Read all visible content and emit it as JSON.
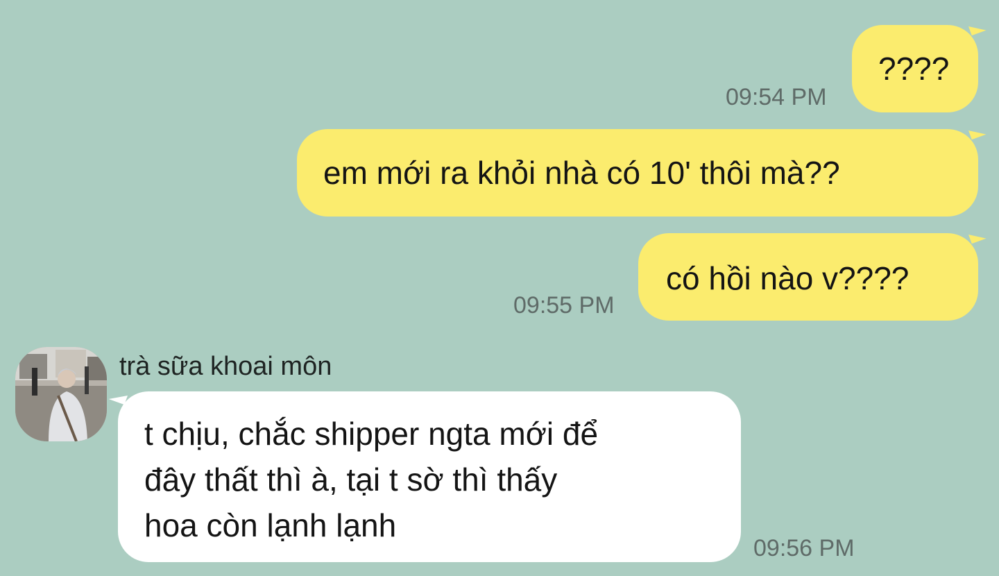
{
  "messages": [
    {
      "direction": "out",
      "text": "????",
      "time": "09:54 PM"
    },
    {
      "direction": "out",
      "text": "em mới ra khỏi nhà có 10' thôi mà??",
      "time": ""
    },
    {
      "direction": "out",
      "text": "có hồi nào v????",
      "time": "09:55 PM"
    },
    {
      "direction": "in",
      "sender": "trà sữa khoai môn",
      "lines": [
        "t chịu, chắc shipper ngta mới để",
        "đây thất thì à, tại t sờ thì thấy",
        "hoa còn lạnh lạnh"
      ],
      "time": "09:56 PM"
    }
  ],
  "colors": {
    "background": "#abcdc1",
    "outgoing_bubble": "#fbec6e",
    "incoming_bubble": "#ffffff",
    "timestamp": "#5f6b68"
  },
  "icons": {
    "sender_avatar": "profile-photo-avatar"
  }
}
